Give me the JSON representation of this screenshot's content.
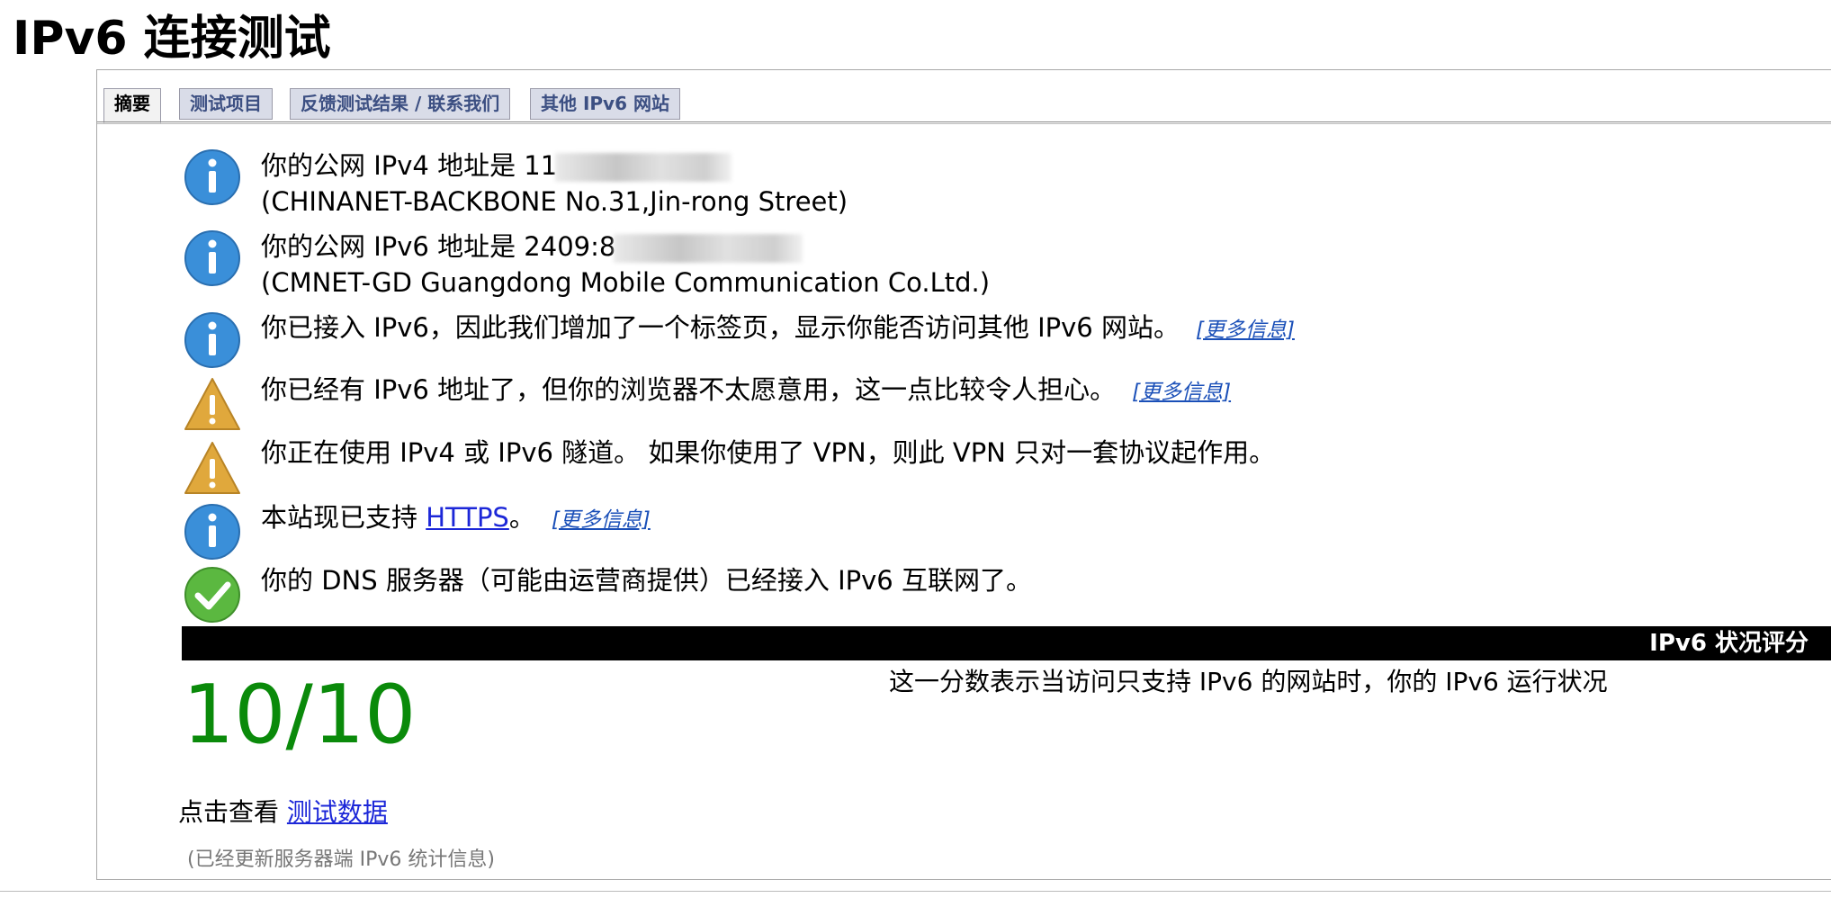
{
  "page": {
    "title": "IPv6 连接测试"
  },
  "tabs": [
    {
      "label": "摘要",
      "active": true
    },
    {
      "label": "测试项目",
      "active": false
    },
    {
      "label": "反馈测试结果 / 联系我们",
      "active": false
    },
    {
      "label": "其他 IPv6 网站",
      "active": false
    }
  ],
  "colors": {
    "info_icon": "#3a8fd9",
    "warning_icon": "#e0a83c",
    "ok_icon": "#5bb840",
    "score": "#0a8a0a",
    "link": "#1c27d8"
  },
  "messages": [
    {
      "icon": "info-icon",
      "line1": "你的公网 IPv4 地址是 11",
      "line2": "(CHINANET-BACKBONE No.31,Jin-rong Street)"
    },
    {
      "icon": "info-icon",
      "line1": "你的公网 IPv6 地址是 2409:8",
      "line2": "(CMNET-GD Guangdong Mobile Communication Co.Ltd.)"
    },
    {
      "icon": "info-icon",
      "text": "你已接入 IPv6，因此我们增加了一个标签页，显示你能否访问其他 IPv6 网站。",
      "more": "[更多信息]"
    },
    {
      "icon": "warning-icon",
      "text": "你已经有 IPv6 地址了，但你的浏览器不太愿意用，这一点比较令人担心。",
      "more": "[更多信息]"
    },
    {
      "icon": "warning-icon",
      "text": "你正在使用 IPv4 或 IPv6 隧道。 如果你使用了 VPN，则此 VPN 只对一套协议起作用。"
    },
    {
      "icon": "info-icon",
      "text_before": "本站现已支持 ",
      "link": "HTTPS",
      "text_after": "。",
      "more": "[更多信息]"
    },
    {
      "icon": "check-icon",
      "text": "你的 DNS 服务器（可能由运营商提供）已经接入 IPv6 互联网了。"
    }
  ],
  "score": {
    "header": "IPv6 状况评分",
    "value": "10/10",
    "description": "这一分数表示当访问只支持 IPv6 的网站时，你的 IPv6 运行状况"
  },
  "footer": {
    "view_prefix": "点击查看 ",
    "view_link": "测试数据",
    "update_note": "(已经更新服务器端 IPv6 统计信息)"
  }
}
